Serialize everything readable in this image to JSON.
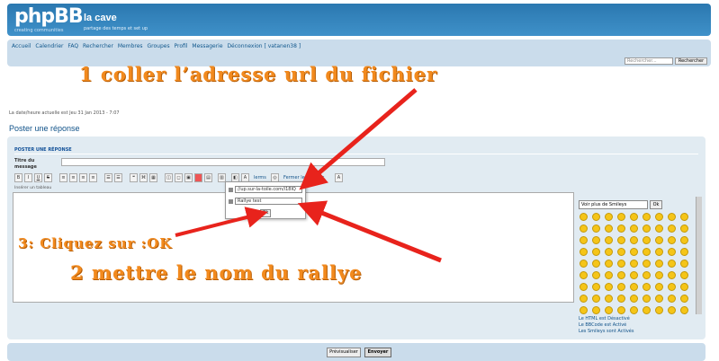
{
  "header": {
    "logo": "phpBB",
    "logo_sub": "creating communities",
    "site_title": "la cave",
    "site_desc": "partage des temps et set up"
  },
  "nav": {
    "items": [
      "Accueil",
      "Calendrier",
      "FAQ",
      "Rechercher",
      "Membres",
      "Groupes",
      "Profil",
      "Messagerie",
      "Déconnexion [ vatanen38 ]"
    ],
    "search_placeholder": "Rechercher...",
    "search_button": "Rechercher"
  },
  "page": {
    "current_time": "La date/heure actuelle est Jeu 31 Jan 2013 - 7:07",
    "title": "Poster une réponse"
  },
  "form": {
    "panel_title": "POSTER UNE RÉPONSE",
    "subject_label": "Titre du message",
    "bbcode_hint": "Insérer un tableau",
    "close_tags": "Fermer les Balises",
    "toolbar_misc": "lerms"
  },
  "popup": {
    "url_value": "//up.sur-la-toile.com/i18IQ",
    "name_value": "Rallye test",
    "ok": "Ok"
  },
  "smileys": {
    "select_value": "Voir plus de Smileys",
    "ok": "Ok"
  },
  "info": {
    "line1": "Le HTML est Désactivé",
    "line2": "Le BBCode est Activé",
    "line3": "Les Smileys sont Activés"
  },
  "buttons": {
    "preview": "Prévisualiser",
    "submit": "Envoyer"
  },
  "annotations": {
    "step1": "1 coller l’adresse url du fichier",
    "step2": "2 mettre le nom du rallye",
    "step3": "3: Cliquez sur :OK"
  },
  "colors": {
    "annotation": "#f28a1e",
    "arrow": "#e8231c",
    "header": "#2b78b0",
    "navbar": "#cadceb"
  }
}
